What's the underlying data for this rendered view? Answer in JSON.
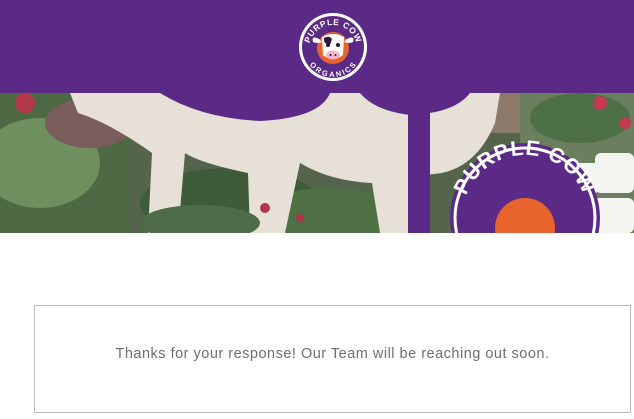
{
  "header": {
    "logo": {
      "line_top": "PURPLE COW",
      "line_bottom": "ORGANICS",
      "icon": "cow-head-icon"
    }
  },
  "hero": {
    "sign_text": "PURPLE COW"
  },
  "confirmation": {
    "message": "Thanks for your response! Our Team will be reaching out soon."
  },
  "colors": {
    "brand_purple": "#5b2a86",
    "logo_orange": "#e8642c",
    "text_gray": "#6e6e6e",
    "border_gray": "#b9b9b9"
  }
}
